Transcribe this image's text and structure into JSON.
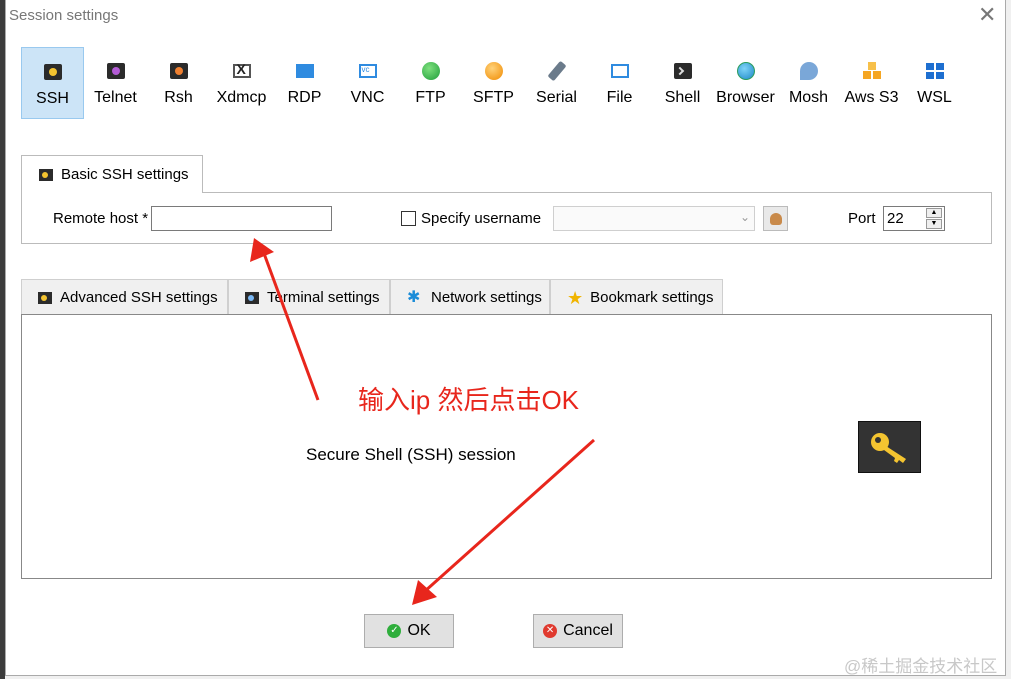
{
  "window": {
    "title": "Session settings",
    "close_glyph": "✕"
  },
  "protocols": [
    {
      "label": "SSH",
      "icon": "ssh-key-icon",
      "active": true
    },
    {
      "label": "Telnet",
      "icon": "telnet-icon"
    },
    {
      "label": "Rsh",
      "icon": "rsh-icon"
    },
    {
      "label": "Xdmcp",
      "icon": "xdmcp-icon"
    },
    {
      "label": "RDP",
      "icon": "rdp-icon"
    },
    {
      "label": "VNC",
      "icon": "vnc-icon"
    },
    {
      "label": "FTP",
      "icon": "ftp-globe-icon"
    },
    {
      "label": "SFTP",
      "icon": "sftp-globe-icon"
    },
    {
      "label": "Serial",
      "icon": "serial-plug-icon"
    },
    {
      "label": "File",
      "icon": "file-icon"
    },
    {
      "label": "Shell",
      "icon": "shell-terminal-icon"
    },
    {
      "label": "Browser",
      "icon": "browser-globe-icon"
    },
    {
      "label": "Mosh",
      "icon": "mosh-dish-icon"
    },
    {
      "label": "Aws S3",
      "icon": "aws-cubes-icon"
    },
    {
      "label": "WSL",
      "icon": "wsl-windows-icon"
    }
  ],
  "basic": {
    "tab_label": "Basic SSH settings",
    "remote_host_label": "Remote host *",
    "remote_host_value": "",
    "specify_username_label": "Specify username",
    "username_value": "",
    "port_label": "Port",
    "port_value": "22"
  },
  "lower_tabs": [
    {
      "label": "Advanced SSH settings"
    },
    {
      "label": "Terminal settings"
    },
    {
      "label": "Network settings"
    },
    {
      "label": "Bookmark settings"
    }
  ],
  "panel": {
    "description": "Secure Shell (SSH) session"
  },
  "buttons": {
    "ok": "OK",
    "cancel": "Cancel"
  },
  "annotation": {
    "text": "输入ip 然后点击OK",
    "color": "#e8261c"
  },
  "watermark": "@稀土掘金技术社区"
}
